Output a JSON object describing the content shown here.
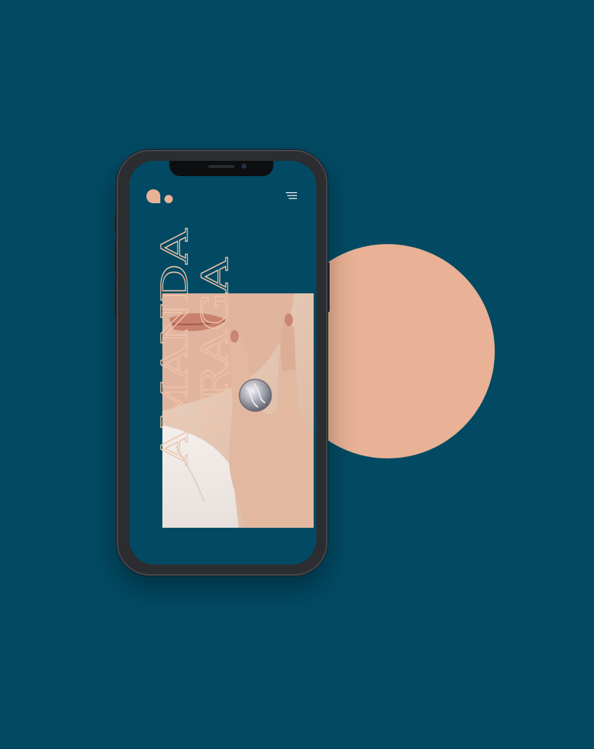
{
  "brand": {
    "first_name": "AMANDA",
    "last_name": "BRAGA"
  },
  "icons": {
    "logo": "logo-mark",
    "menu": "hamburger-menu-icon"
  },
  "colors": {
    "background": "#024a63",
    "accent": "#e9b195",
    "title_outline": "#f0c4ab",
    "phone_frame": "#2b2d31"
  }
}
